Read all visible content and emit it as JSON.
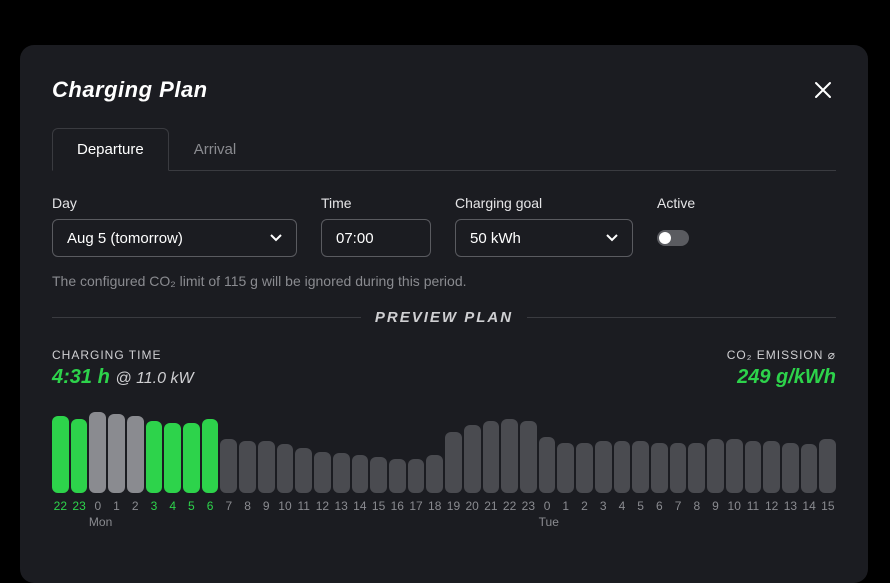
{
  "modal": {
    "title": "Charging Plan"
  },
  "tabs": {
    "departure": "Departure",
    "arrival": "Arrival"
  },
  "fields": {
    "day": {
      "label": "Day",
      "value": "Aug 5 (tomorrow)"
    },
    "time": {
      "label": "Time",
      "value": "07:00"
    },
    "goal": {
      "label": "Charging goal",
      "value": "50 kWh"
    },
    "active": {
      "label": "Active",
      "value": false
    }
  },
  "hint": "The configured CO₂ limit of 115 g will be ignored during this period.",
  "preview": {
    "label": "PREVIEW PLAN",
    "charging_time": {
      "label": "CHARGING TIME",
      "value": "4:31 h",
      "sub": "@ 11.0 kW"
    },
    "co2": {
      "label": "CO₂ EMISSION ⌀",
      "value": "249 g/kWh"
    }
  },
  "chart_data": {
    "type": "bar",
    "xlabel": "",
    "ylabel": "",
    "hours": [
      22,
      23,
      0,
      1,
      2,
      3,
      4,
      5,
      6,
      7,
      8,
      9,
      10,
      11,
      12,
      13,
      14,
      15,
      16,
      17,
      18,
      19,
      20,
      21,
      22,
      23,
      0,
      1,
      2,
      3,
      4,
      5,
      6,
      7,
      8,
      9,
      10,
      11,
      12,
      13,
      14,
      15
    ],
    "heights": [
      86,
      82,
      90,
      88,
      86,
      80,
      78,
      78,
      82,
      60,
      58,
      58,
      54,
      50,
      46,
      44,
      42,
      40,
      38,
      38,
      42,
      68,
      76,
      80,
      82,
      80,
      62,
      56,
      56,
      58,
      58,
      58,
      56,
      56,
      56,
      60,
      60,
      58,
      58,
      56,
      54,
      60
    ],
    "slot_active": [
      true,
      true,
      false,
      false,
      false,
      true,
      true,
      true,
      true,
      false,
      false,
      false,
      false,
      false,
      false,
      false,
      false,
      false,
      false,
      false,
      false,
      false,
      false,
      false,
      false,
      false,
      false,
      false,
      false,
      false,
      false,
      false,
      false,
      false,
      false,
      false,
      false,
      false,
      false,
      false,
      false,
      false
    ],
    "light": [
      false,
      false,
      true,
      true,
      true,
      false,
      false,
      false,
      false,
      false,
      false,
      false,
      false,
      false,
      false,
      false,
      false,
      false,
      false,
      false,
      false,
      false,
      false,
      false,
      false,
      false,
      false,
      false,
      false,
      false,
      false,
      false,
      false,
      false,
      false,
      false,
      false,
      false,
      false,
      false,
      false,
      false
    ],
    "day_markers": {
      "mon_index": 2,
      "mon_label": "Mon",
      "tue_index": 26,
      "tue_label": "Tue"
    }
  }
}
